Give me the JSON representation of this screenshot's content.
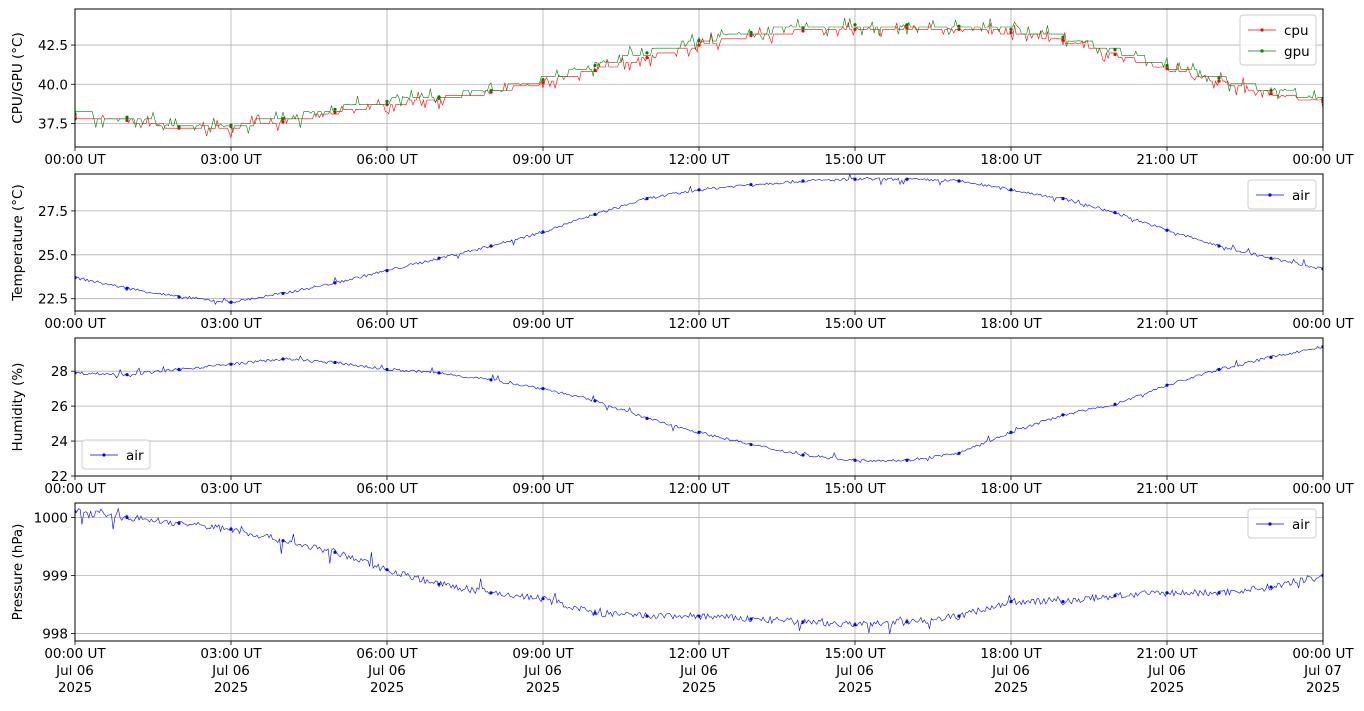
{
  "chart_data": [
    {
      "type": "line",
      "ylabel": "CPU/GPU (°C)",
      "xlim": [
        "2025-07-06 00:00",
        "2025-07-07 00:00"
      ],
      "ylim": [
        36.0,
        44.8
      ],
      "yticks": [
        37.5,
        40.0,
        42.5
      ],
      "ytick_labels": [
        "37.5",
        "40.0",
        "42.5"
      ],
      "grid": true,
      "legend_position": "top-right",
      "series": [
        {
          "name": "cpu",
          "color": "#ff0000",
          "x": [
            "00:00",
            "01:00",
            "02:00",
            "03:00",
            "04:00",
            "05:00",
            "06:00",
            "07:00",
            "08:00",
            "09:00",
            "10:00",
            "11:00",
            "12:00",
            "13:00",
            "14:00",
            "15:00",
            "16:00",
            "17:00",
            "18:00",
            "19:00",
            "20:00",
            "21:00",
            "22:00",
            "23:00",
            "24:00"
          ],
          "y": [
            37.8,
            37.7,
            37.2,
            37.3,
            37.6,
            38.2,
            38.7,
            39.1,
            39.5,
            40.1,
            40.9,
            41.7,
            42.5,
            43.1,
            43.4,
            43.5,
            43.6,
            43.5,
            43.3,
            42.8,
            41.9,
            41.0,
            40.2,
            39.4,
            38.9
          ]
        },
        {
          "name": "gpu",
          "color": "#008000",
          "x": [
            "00:00",
            "01:00",
            "02:00",
            "03:00",
            "04:00",
            "05:00",
            "06:00",
            "07:00",
            "08:00",
            "09:00",
            "10:00",
            "11:00",
            "12:00",
            "13:00",
            "14:00",
            "15:00",
            "16:00",
            "17:00",
            "18:00",
            "19:00",
            "20:00",
            "21:00",
            "22:00",
            "23:00",
            "24:00"
          ],
          "y": [
            38.1,
            37.9,
            37.3,
            37.4,
            37.8,
            38.4,
            38.9,
            39.2,
            39.6,
            40.3,
            41.2,
            42.0,
            42.8,
            43.3,
            43.6,
            43.8,
            43.8,
            43.7,
            43.5,
            43.0,
            42.2,
            41.2,
            40.4,
            39.6,
            39.1
          ]
        }
      ]
    },
    {
      "type": "line",
      "ylabel": "Temperature (°C)",
      "xlim": [
        "2025-07-06 00:00",
        "2025-07-07 00:00"
      ],
      "ylim": [
        21.8,
        29.6
      ],
      "yticks": [
        22.5,
        25.0,
        27.5
      ],
      "ytick_labels": [
        "22.5",
        "25.0",
        "27.5"
      ],
      "grid": true,
      "legend_position": "top-right",
      "series": [
        {
          "name": "air",
          "color": "#0000ff",
          "x": [
            "00:00",
            "01:00",
            "02:00",
            "03:00",
            "04:00",
            "05:00",
            "06:00",
            "07:00",
            "08:00",
            "09:00",
            "10:00",
            "11:00",
            "12:00",
            "13:00",
            "14:00",
            "15:00",
            "16:00",
            "17:00",
            "18:00",
            "19:00",
            "20:00",
            "21:00",
            "22:00",
            "23:00",
            "24:00"
          ],
          "y": [
            23.7,
            23.1,
            22.6,
            22.3,
            22.8,
            23.4,
            24.1,
            24.8,
            25.5,
            26.3,
            27.3,
            28.2,
            28.7,
            29.0,
            29.2,
            29.3,
            29.3,
            29.2,
            28.7,
            28.2,
            27.4,
            26.4,
            25.5,
            24.8,
            24.2
          ]
        }
      ]
    },
    {
      "type": "line",
      "ylabel": "Humidity (%)",
      "xlim": [
        "2025-07-06 00:00",
        "2025-07-07 00:00"
      ],
      "ylim": [
        22.0,
        29.9
      ],
      "yticks": [
        22,
        24,
        26,
        28
      ],
      "ytick_labels": [
        "22",
        "24",
        "26",
        "28"
      ],
      "grid": true,
      "legend_position": "bottom-left",
      "series": [
        {
          "name": "air",
          "color": "#0000ff",
          "x": [
            "00:00",
            "01:00",
            "02:00",
            "03:00",
            "04:00",
            "05:00",
            "06:00",
            "07:00",
            "08:00",
            "09:00",
            "10:00",
            "11:00",
            "12:00",
            "13:00",
            "14:00",
            "15:00",
            "16:00",
            "17:00",
            "18:00",
            "19:00",
            "20:00",
            "21:00",
            "22:00",
            "23:00",
            "24:00"
          ],
          "y": [
            27.9,
            27.8,
            28.1,
            28.4,
            28.7,
            28.5,
            28.1,
            27.9,
            27.5,
            27.0,
            26.3,
            25.3,
            24.5,
            23.8,
            23.2,
            22.9,
            22.9,
            23.3,
            24.5,
            25.5,
            26.1,
            27.2,
            28.1,
            28.8,
            29.4
          ]
        }
      ]
    },
    {
      "type": "line",
      "ylabel": "Pressure (hPa)",
      "xlim": [
        "2025-07-06 00:00",
        "2025-07-07 00:00"
      ],
      "ylim": [
        997.87,
        1000.25
      ],
      "yticks": [
        998,
        999,
        1000
      ],
      "ytick_labels": [
        "998",
        "999",
        "1000"
      ],
      "grid": true,
      "legend_position": "top-right",
      "series": [
        {
          "name": "air",
          "color": "#0000ff",
          "x": [
            "00:00",
            "01:00",
            "02:00",
            "03:00",
            "04:00",
            "05:00",
            "06:00",
            "07:00",
            "08:00",
            "09:00",
            "10:00",
            "11:00",
            "12:00",
            "13:00",
            "14:00",
            "15:00",
            "16:00",
            "17:00",
            "18:00",
            "19:00",
            "20:00",
            "21:00",
            "22:00",
            "23:00",
            "24:00"
          ],
          "y": [
            1000.1,
            1000.0,
            999.9,
            999.8,
            999.6,
            999.4,
            999.1,
            998.85,
            998.7,
            998.6,
            998.35,
            998.3,
            998.3,
            998.25,
            998.2,
            998.15,
            998.2,
            998.3,
            998.55,
            998.55,
            998.65,
            998.7,
            998.7,
            998.8,
            999.0
          ]
        }
      ]
    }
  ],
  "x_axis": {
    "tick_labels": [
      "00:00 UT",
      "03:00 UT",
      "06:00 UT",
      "09:00 UT",
      "12:00 UT",
      "15:00 UT",
      "18:00 UT",
      "21:00 UT",
      "00:00 UT"
    ],
    "bottom_dates": [
      "Jul 06",
      "Jul 06",
      "Jul 06",
      "Jul 06",
      "Jul 06",
      "Jul 06",
      "Jul 06",
      "Jul 06",
      "Jul 07"
    ],
    "bottom_years": [
      "2025",
      "2025",
      "2025",
      "2025",
      "2025",
      "2025",
      "2025",
      "2025",
      "2025"
    ]
  }
}
